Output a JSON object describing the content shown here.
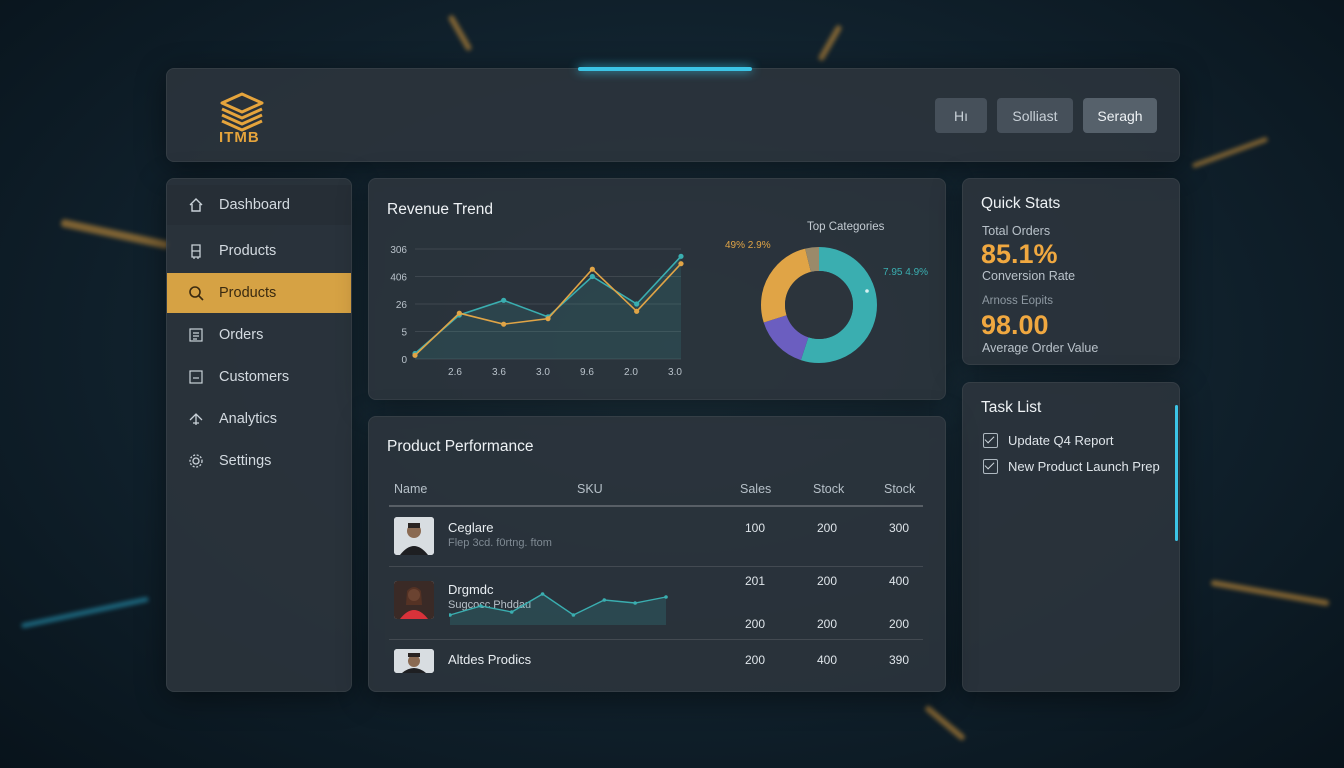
{
  "app": {
    "logo_text": "ITMB"
  },
  "header": {
    "buttons": [
      {
        "label": "Hı"
      },
      {
        "label": "Solliast"
      },
      {
        "label": "Seragh"
      }
    ]
  },
  "sidebar": {
    "items": [
      {
        "label": "Dashboard",
        "icon": "home-icon"
      },
      {
        "label": "Products",
        "icon": "box-icon"
      },
      {
        "label": "Products",
        "icon": "search-icon",
        "active": true
      },
      {
        "label": "Orders",
        "icon": "list-icon"
      },
      {
        "label": "Customers",
        "icon": "user-box-icon"
      },
      {
        "label": "Analytics",
        "icon": "analytics-icon"
      },
      {
        "label": "Settings",
        "icon": "gear-icon"
      }
    ]
  },
  "revenue": {
    "title": "Revenue Trend"
  },
  "categories": {
    "title": "Top Categories",
    "left_label": "49% 2.9%",
    "right_label": "7.95 4.9%"
  },
  "colors": {
    "accent": "#d6a244",
    "teal": "#3aaeb0",
    "orange": "#e0a446",
    "purple": "#6b5ec0",
    "brand": "#e5a43c"
  },
  "chart_data": [
    {
      "type": "line",
      "title": "Revenue Trend",
      "yticks": [
        "306",
        "406",
        "26",
        "5",
        "0"
      ],
      "xticks": [
        "2.6",
        "3.6",
        "3.0",
        "9.6",
        "2.0",
        "3.0"
      ],
      "series": [
        {
          "color": "#3aaeb0",
          "values": [
            0.3,
            2.4,
            3.2,
            2.3,
            4.5,
            3.0,
            5.6
          ]
        },
        {
          "color": "#e0a446",
          "values": [
            0.2,
            2.5,
            1.9,
            2.2,
            4.9,
            2.6,
            5.2
          ]
        }
      ]
    },
    {
      "type": "pie",
      "title": "Top Categories",
      "slices": [
        {
          "value": 0.55,
          "color": "#3aaeb0"
        },
        {
          "value": 0.15,
          "color": "#6b5ec0"
        },
        {
          "value": 0.26,
          "color": "#e0a446"
        },
        {
          "value": 0.04,
          "color": "#9a8a6a"
        }
      ]
    }
  ],
  "quick_stats": {
    "title": "Quick Stats",
    "label1": "Total Orders",
    "value1": "85.1%",
    "label2": "Conversion Rate",
    "label3": "Arnoss Eopits",
    "value2": "98.00",
    "label4": "Average Order Value"
  },
  "tasks": {
    "title": "Task List",
    "items": [
      "Update Q4 Report",
      "New Product Launch Prep"
    ]
  },
  "performance": {
    "title": "Product Performance",
    "headers": [
      "Name",
      "SKU",
      "Sales",
      "Stock",
      "Stock"
    ],
    "rows": [
      {
        "name": "Ceglare",
        "sub": "Flep 3cd. f0rtng. ftom",
        "cells": [
          "100",
          "200",
          "300"
        ]
      },
      {
        "name": "Drgmdc",
        "sub": "Sugcocc Phddau",
        "cells": [
          "201",
          "200",
          "400"
        ],
        "cells2": [
          "200",
          "200",
          "200"
        ]
      },
      {
        "name": "Altdes Prodics",
        "sub": "",
        "cells": [
          "200",
          "400",
          "390"
        ]
      }
    ],
    "sparkline": [
      0.2,
      0.5,
      0.3,
      0.9,
      0.2,
      0.7,
      0.6,
      0.8
    ]
  }
}
